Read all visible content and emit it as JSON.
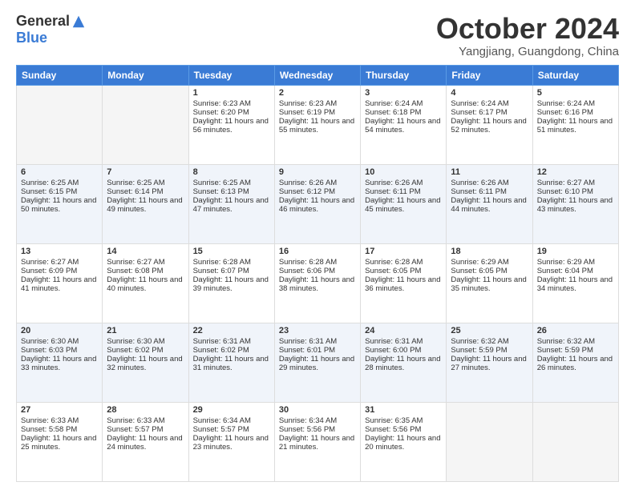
{
  "logo": {
    "general": "General",
    "blue": "Blue"
  },
  "title": "October 2024",
  "subtitle": "Yangjiang, Guangdong, China",
  "headers": [
    "Sunday",
    "Monday",
    "Tuesday",
    "Wednesday",
    "Thursday",
    "Friday",
    "Saturday"
  ],
  "weeks": [
    [
      {
        "day": "",
        "sunrise": "",
        "sunset": "",
        "daylight": ""
      },
      {
        "day": "",
        "sunrise": "",
        "sunset": "",
        "daylight": ""
      },
      {
        "day": "1",
        "sunrise": "Sunrise: 6:23 AM",
        "sunset": "Sunset: 6:20 PM",
        "daylight": "Daylight: 11 hours and 56 minutes."
      },
      {
        "day": "2",
        "sunrise": "Sunrise: 6:23 AM",
        "sunset": "Sunset: 6:19 PM",
        "daylight": "Daylight: 11 hours and 55 minutes."
      },
      {
        "day": "3",
        "sunrise": "Sunrise: 6:24 AM",
        "sunset": "Sunset: 6:18 PM",
        "daylight": "Daylight: 11 hours and 54 minutes."
      },
      {
        "day": "4",
        "sunrise": "Sunrise: 6:24 AM",
        "sunset": "Sunset: 6:17 PM",
        "daylight": "Daylight: 11 hours and 52 minutes."
      },
      {
        "day": "5",
        "sunrise": "Sunrise: 6:24 AM",
        "sunset": "Sunset: 6:16 PM",
        "daylight": "Daylight: 11 hours and 51 minutes."
      }
    ],
    [
      {
        "day": "6",
        "sunrise": "Sunrise: 6:25 AM",
        "sunset": "Sunset: 6:15 PM",
        "daylight": "Daylight: 11 hours and 50 minutes."
      },
      {
        "day": "7",
        "sunrise": "Sunrise: 6:25 AM",
        "sunset": "Sunset: 6:14 PM",
        "daylight": "Daylight: 11 hours and 49 minutes."
      },
      {
        "day": "8",
        "sunrise": "Sunrise: 6:25 AM",
        "sunset": "Sunset: 6:13 PM",
        "daylight": "Daylight: 11 hours and 47 minutes."
      },
      {
        "day": "9",
        "sunrise": "Sunrise: 6:26 AM",
        "sunset": "Sunset: 6:12 PM",
        "daylight": "Daylight: 11 hours and 46 minutes."
      },
      {
        "day": "10",
        "sunrise": "Sunrise: 6:26 AM",
        "sunset": "Sunset: 6:11 PM",
        "daylight": "Daylight: 11 hours and 45 minutes."
      },
      {
        "day": "11",
        "sunrise": "Sunrise: 6:26 AM",
        "sunset": "Sunset: 6:11 PM",
        "daylight": "Daylight: 11 hours and 44 minutes."
      },
      {
        "day": "12",
        "sunrise": "Sunrise: 6:27 AM",
        "sunset": "Sunset: 6:10 PM",
        "daylight": "Daylight: 11 hours and 43 minutes."
      }
    ],
    [
      {
        "day": "13",
        "sunrise": "Sunrise: 6:27 AM",
        "sunset": "Sunset: 6:09 PM",
        "daylight": "Daylight: 11 hours and 41 minutes."
      },
      {
        "day": "14",
        "sunrise": "Sunrise: 6:27 AM",
        "sunset": "Sunset: 6:08 PM",
        "daylight": "Daylight: 11 hours and 40 minutes."
      },
      {
        "day": "15",
        "sunrise": "Sunrise: 6:28 AM",
        "sunset": "Sunset: 6:07 PM",
        "daylight": "Daylight: 11 hours and 39 minutes."
      },
      {
        "day": "16",
        "sunrise": "Sunrise: 6:28 AM",
        "sunset": "Sunset: 6:06 PM",
        "daylight": "Daylight: 11 hours and 38 minutes."
      },
      {
        "day": "17",
        "sunrise": "Sunrise: 6:28 AM",
        "sunset": "Sunset: 6:05 PM",
        "daylight": "Daylight: 11 hours and 36 minutes."
      },
      {
        "day": "18",
        "sunrise": "Sunrise: 6:29 AM",
        "sunset": "Sunset: 6:05 PM",
        "daylight": "Daylight: 11 hours and 35 minutes."
      },
      {
        "day": "19",
        "sunrise": "Sunrise: 6:29 AM",
        "sunset": "Sunset: 6:04 PM",
        "daylight": "Daylight: 11 hours and 34 minutes."
      }
    ],
    [
      {
        "day": "20",
        "sunrise": "Sunrise: 6:30 AM",
        "sunset": "Sunset: 6:03 PM",
        "daylight": "Daylight: 11 hours and 33 minutes."
      },
      {
        "day": "21",
        "sunrise": "Sunrise: 6:30 AM",
        "sunset": "Sunset: 6:02 PM",
        "daylight": "Daylight: 11 hours and 32 minutes."
      },
      {
        "day": "22",
        "sunrise": "Sunrise: 6:31 AM",
        "sunset": "Sunset: 6:02 PM",
        "daylight": "Daylight: 11 hours and 31 minutes."
      },
      {
        "day": "23",
        "sunrise": "Sunrise: 6:31 AM",
        "sunset": "Sunset: 6:01 PM",
        "daylight": "Daylight: 11 hours and 29 minutes."
      },
      {
        "day": "24",
        "sunrise": "Sunrise: 6:31 AM",
        "sunset": "Sunset: 6:00 PM",
        "daylight": "Daylight: 11 hours and 28 minutes."
      },
      {
        "day": "25",
        "sunrise": "Sunrise: 6:32 AM",
        "sunset": "Sunset: 5:59 PM",
        "daylight": "Daylight: 11 hours and 27 minutes."
      },
      {
        "day": "26",
        "sunrise": "Sunrise: 6:32 AM",
        "sunset": "Sunset: 5:59 PM",
        "daylight": "Daylight: 11 hours and 26 minutes."
      }
    ],
    [
      {
        "day": "27",
        "sunrise": "Sunrise: 6:33 AM",
        "sunset": "Sunset: 5:58 PM",
        "daylight": "Daylight: 11 hours and 25 minutes."
      },
      {
        "day": "28",
        "sunrise": "Sunrise: 6:33 AM",
        "sunset": "Sunset: 5:57 PM",
        "daylight": "Daylight: 11 hours and 24 minutes."
      },
      {
        "day": "29",
        "sunrise": "Sunrise: 6:34 AM",
        "sunset": "Sunset: 5:57 PM",
        "daylight": "Daylight: 11 hours and 23 minutes."
      },
      {
        "day": "30",
        "sunrise": "Sunrise: 6:34 AM",
        "sunset": "Sunset: 5:56 PM",
        "daylight": "Daylight: 11 hours and 21 minutes."
      },
      {
        "day": "31",
        "sunrise": "Sunrise: 6:35 AM",
        "sunset": "Sunset: 5:56 PM",
        "daylight": "Daylight: 11 hours and 20 minutes."
      },
      {
        "day": "",
        "sunrise": "",
        "sunset": "",
        "daylight": ""
      },
      {
        "day": "",
        "sunrise": "",
        "sunset": "",
        "daylight": ""
      }
    ]
  ]
}
